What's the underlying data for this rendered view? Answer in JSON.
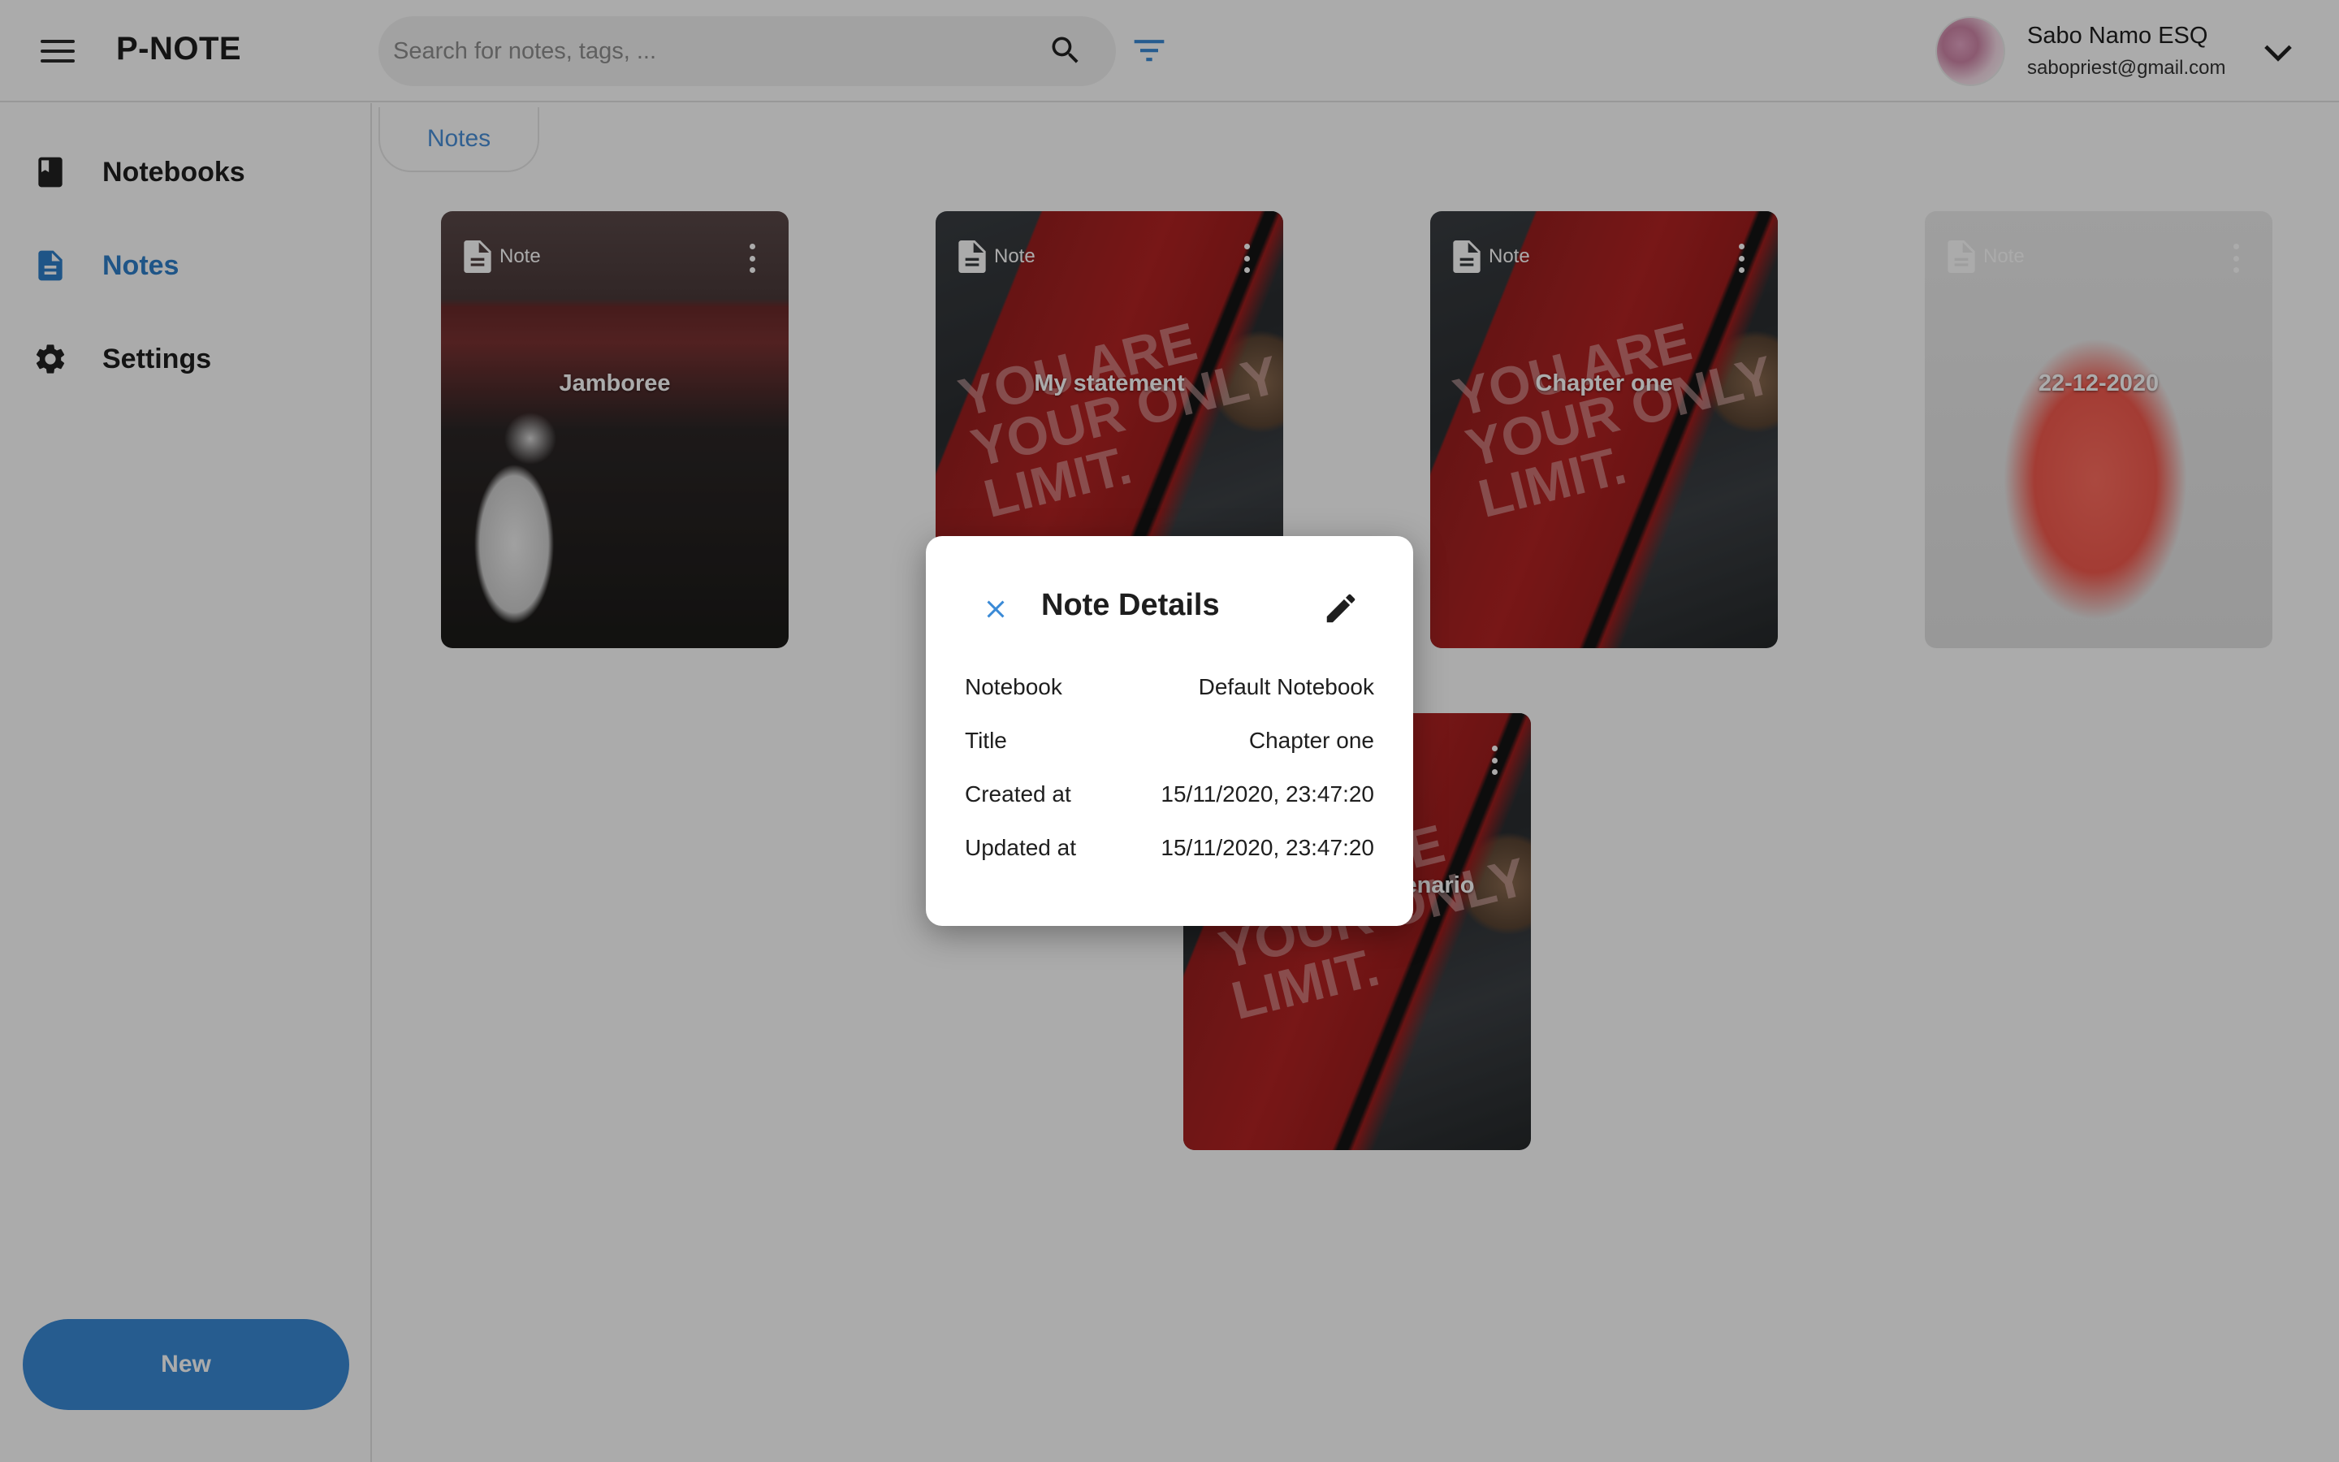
{
  "header": {
    "app_title": "P-NOTE",
    "search_placeholder": "Search for notes, tags, ...",
    "user_name": "Sabo Namo ESQ",
    "user_email": "sabopriest@gmail.com"
  },
  "sidebar": {
    "items": [
      {
        "label": "Notebooks",
        "icon": "book-icon",
        "active": false
      },
      {
        "label": "Notes",
        "icon": "note-icon",
        "active": true
      },
      {
        "label": "Settings",
        "icon": "gear-icon",
        "active": false
      }
    ],
    "new_label": "New"
  },
  "main": {
    "breadcrumb": "Notes",
    "cards": [
      {
        "type": "Note",
        "title": "Jamboree"
      },
      {
        "type": "Note",
        "title": "My statement"
      },
      {
        "type": "Note",
        "title": "Chapter one"
      },
      {
        "type": "Note",
        "title": "22-12-2020"
      },
      {
        "type": "Note",
        "title": "The African Scenario"
      }
    ],
    "book_cover_text": "YOU ARE YOUR ONLY LIMIT."
  },
  "dialog": {
    "title": "Note Details",
    "rows": [
      {
        "label": "Notebook",
        "value": "Default Notebook"
      },
      {
        "label": "Title",
        "value": "Chapter one"
      },
      {
        "label": "Created at",
        "value": "15/11/2020, 23:47:20"
      },
      {
        "label": "Updated at",
        "value": "15/11/2020, 23:47:20"
      }
    ]
  },
  "colors": {
    "accent": "#3a8ad6",
    "active_nav": "#2f7fc9",
    "scrim": "rgba(0,0,0,0.33)"
  }
}
